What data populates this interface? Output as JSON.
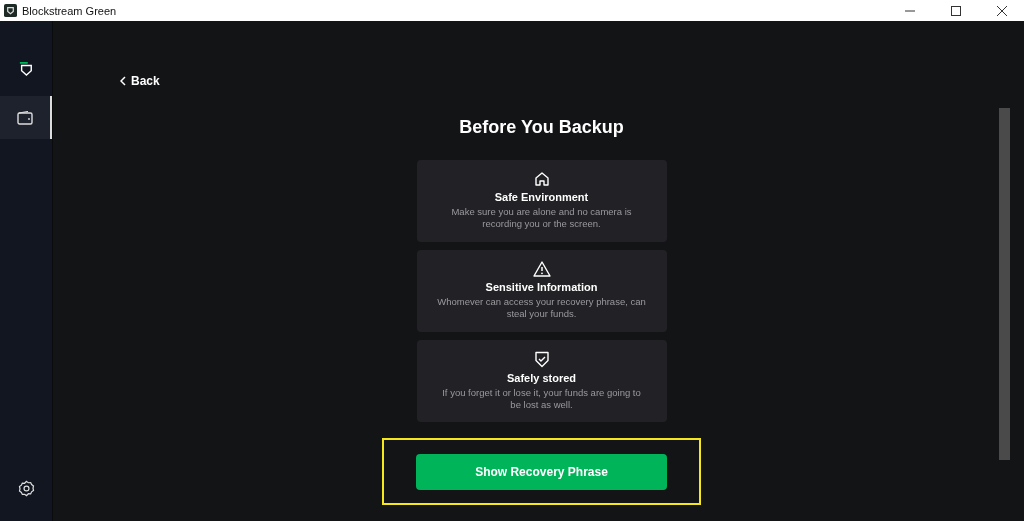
{
  "window": {
    "title": "Blockstream Green"
  },
  "sidebar": {
    "items": [
      {
        "kind": "wallet",
        "selected": true
      }
    ]
  },
  "back": {
    "label": "Back"
  },
  "heading": "Before You Backup",
  "cards": [
    {
      "kind": "home",
      "title": "Safe Environment",
      "text": "Make sure you are alone and no camera is recording you or the screen."
    },
    {
      "kind": "warning",
      "title": "Sensitive Information",
      "text": "Whomever can access your recovery phrase, can steal your funds."
    },
    {
      "kind": "shield",
      "title": "Safely stored",
      "text": "If you forget it or lose it, your funds are going to be lost as well."
    }
  ],
  "primary_button": {
    "label": "Show Recovery Phrase",
    "highlighted": true
  }
}
